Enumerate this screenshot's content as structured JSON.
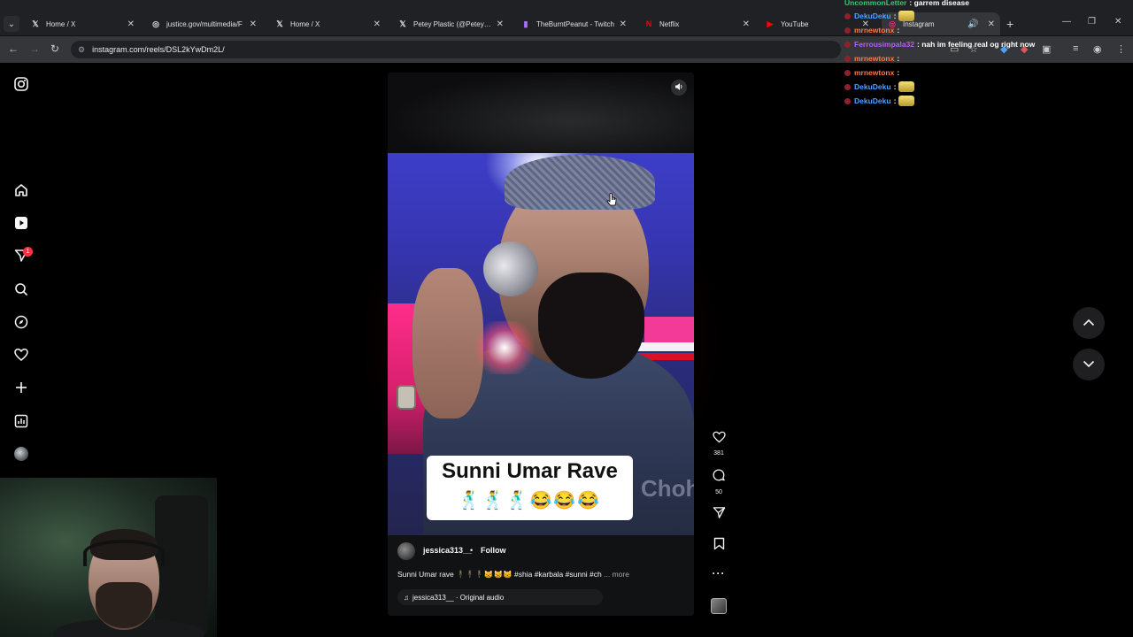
{
  "browser": {
    "tabs": [
      {
        "label": "Home / X",
        "icon": "x-logo-icon"
      },
      {
        "label": "justice.gov/multimedia/F",
        "icon": "globe-icon"
      },
      {
        "label": "Home / X",
        "icon": "x-logo-icon"
      },
      {
        "label": "Petey Plastic (@PeteyPlast",
        "icon": "x-logo-icon"
      },
      {
        "label": "TheBurntPeanut - Twitch",
        "icon": "twitch-icon"
      },
      {
        "label": "Netflix",
        "icon": "netflix-icon"
      },
      {
        "label": "YouTube",
        "icon": "youtube-icon"
      },
      {
        "label": "Instagram",
        "icon": "instagram-icon"
      }
    ],
    "url": "instagram.com/reels/DSL2kYwDm2L/"
  },
  "instagram": {
    "sidebar": {
      "notification_badge": "1"
    },
    "reel": {
      "overlay_title": "Sunni Umar Rave",
      "overlay_emojis": "🕺🕺🕺😂😂😂",
      "background_text": "Choha",
      "username": "jessica313__",
      "separator": "•",
      "follow_label": "Follow",
      "caption": "Sunni Umar rave 🕴🕴🕴😸😸😸 #shia #karbala #sunni #ch",
      "caption_more": "... more",
      "audio": "jessica313__ · Original audio",
      "likes": "381",
      "comments": "50"
    }
  },
  "chat": [
    {
      "user": "UncommonLetter",
      "message": ": garrem disease",
      "color": "#2ecc71"
    },
    {
      "user": "DekuDeku",
      "message": ":",
      "color": "#4aa3ff",
      "emote": true
    },
    {
      "user": "mrnewtonx",
      "message": ":",
      "color": "#ff7a3c"
    },
    {
      "user": "Ferrousimpala32",
      "message": ": nah im feeling real og right now",
      "color": "#b85cff"
    },
    {
      "user": "mrnewtonx",
      "message": ":",
      "color": "#ff7a3c"
    },
    {
      "user": "mrnewtonx",
      "message": ":",
      "color": "#ff7a3c"
    },
    {
      "user": "DekuDeku",
      "message": ":",
      "color": "#4aa3ff",
      "emote": true
    },
    {
      "user": "DekuDeku",
      "message": ":",
      "color": "#4aa3ff",
      "emote": true
    }
  ]
}
